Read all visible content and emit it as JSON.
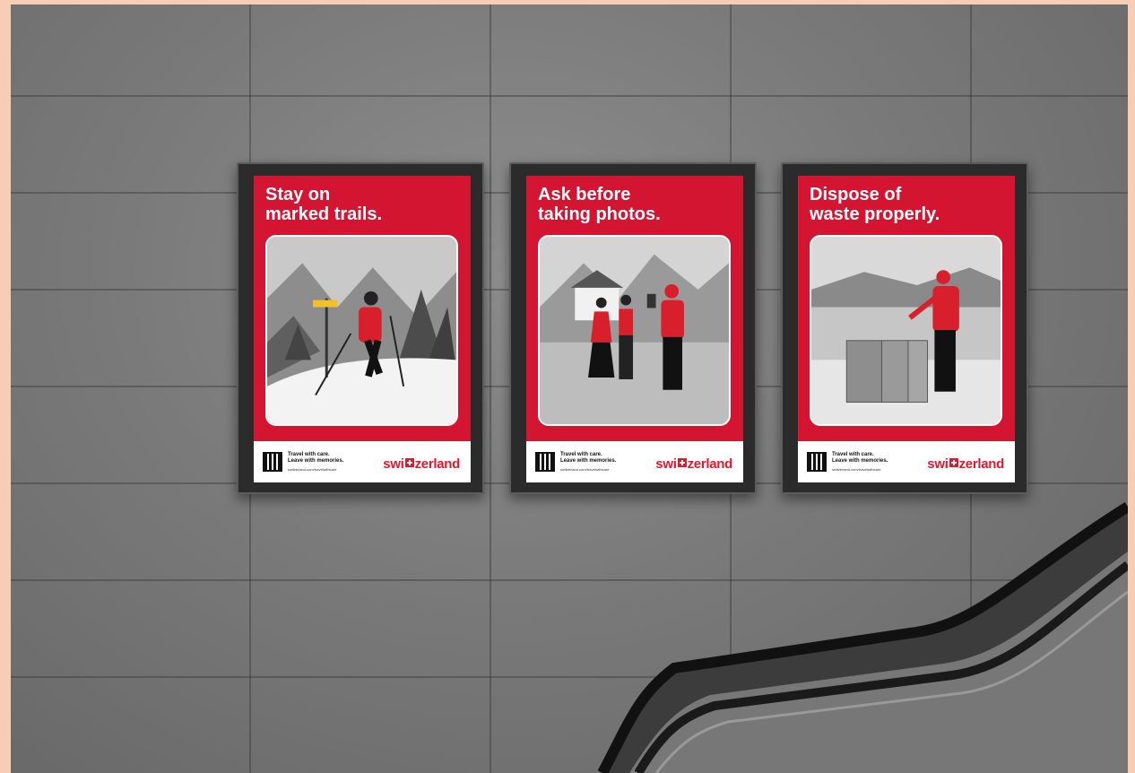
{
  "posters": [
    {
      "headline": "Stay on\nmarked trails.",
      "tagline": "Travel with care.\nLeave with memories.",
      "url": "switzerland.com/travelwithcare",
      "brand_left": "swi",
      "brand_right": "zerland"
    },
    {
      "headline": "Ask before\ntaking photos.",
      "tagline": "Travel with care.\nLeave with memories.",
      "url": "switzerland.com/travelwithcare",
      "brand_left": "swi",
      "brand_right": "zerland"
    },
    {
      "headline": "Dispose of\nwaste properly.",
      "tagline": "Travel with care.\nLeave with memories.",
      "url": "switzerland.com/travelwithcare",
      "brand_left": "swi",
      "brand_right": "zerland"
    }
  ],
  "colors": {
    "poster_red": "#d41532",
    "brand_red": "#e3172d",
    "border_peach": "#f7cdb6"
  }
}
